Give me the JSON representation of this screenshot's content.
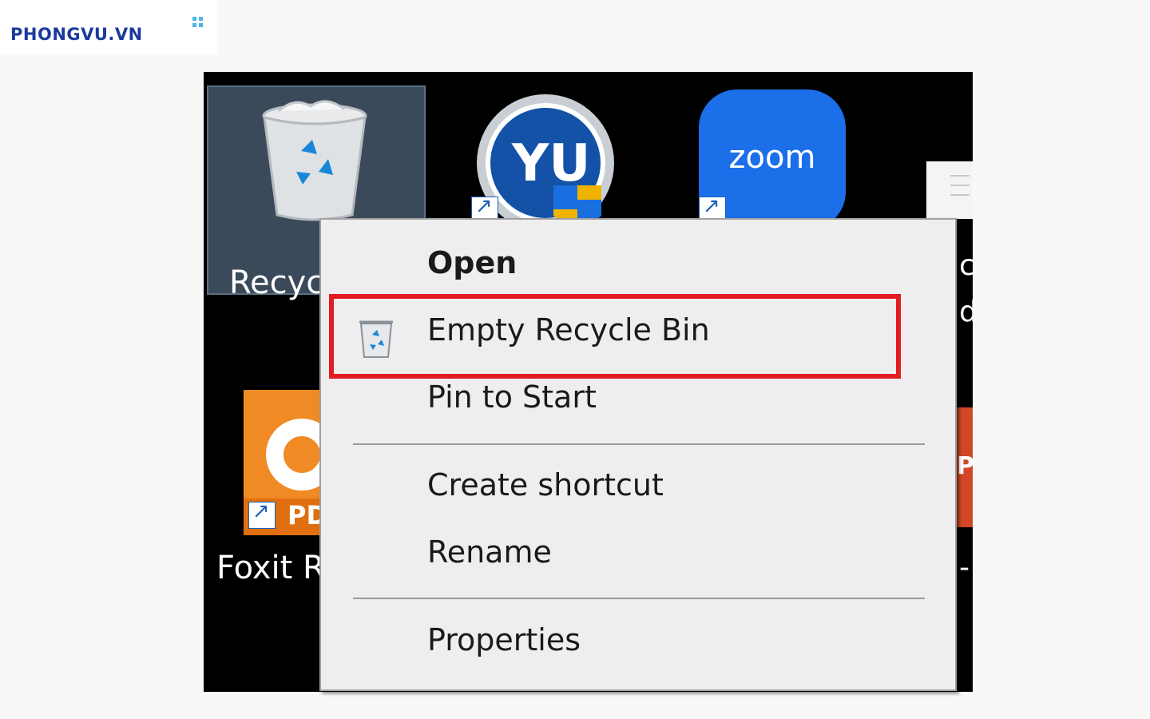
{
  "logo": {
    "text": "PHONGVU.VN",
    "color": "#1a3a9e",
    "dots_color": "#4fb3e8"
  },
  "desktop": {
    "background": "#000000",
    "icons": {
      "recycle_bin": {
        "label": "Recyc",
        "icon": "recycle-bin-icon"
      },
      "foxit": {
        "label": "Foxit R",
        "icon": "foxit-pdf-icon",
        "badge": "PD"
      },
      "yu": {
        "icon": "yu-app-icon",
        "text": "YU"
      },
      "zoom": {
        "icon": "zoom-icon",
        "text": "zoom"
      },
      "document": {
        "icon": "document-icon"
      },
      "powerpoint": {
        "icon": "powerpoint-icon",
        "text": "P"
      }
    },
    "side_chars": [
      "c",
      "d",
      "-"
    ]
  },
  "context_menu": {
    "items": [
      {
        "label": "Open",
        "default": true
      },
      {
        "label": "Empty Recycle Bin",
        "icon": "recycle-bin-small-icon",
        "highlighted": true
      },
      {
        "label": "Pin to Start"
      },
      {
        "label": "Create shortcut"
      },
      {
        "label": "Rename"
      },
      {
        "label": "Properties"
      }
    ],
    "highlight_color": "#e31b23"
  }
}
